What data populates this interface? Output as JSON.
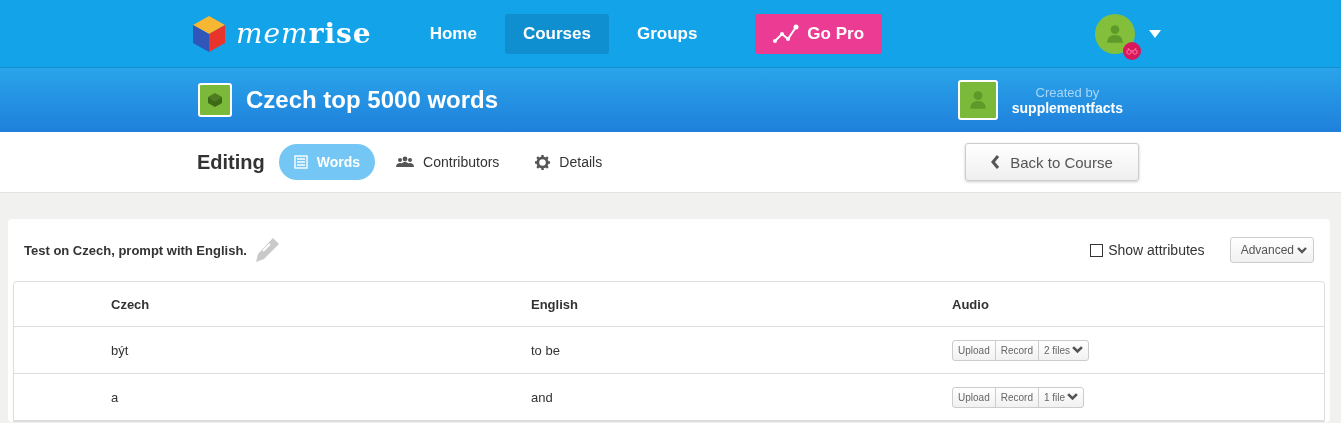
{
  "logo": {
    "text": "mem**rise**"
  },
  "nav": [
    {
      "label": "Home",
      "selected": false
    },
    {
      "label": "Courses",
      "selected": true
    },
    {
      "label": "Groups",
      "selected": false
    }
  ],
  "go_pro": {
    "label": "Go Pro"
  },
  "course": {
    "title": "Czech top 5000 words",
    "created_by_label": "Created by",
    "creator": "supplementfacts"
  },
  "editing": {
    "label": "Editing",
    "tabs": [
      {
        "label": "Words",
        "kind": "list",
        "selected": true
      },
      {
        "label": "Contributors",
        "kind": "people",
        "selected": false
      },
      {
        "label": "Details",
        "kind": "gear",
        "selected": false
      }
    ],
    "back_button": "Back to Course"
  },
  "panel": {
    "description": "Test on Czech, prompt with English.",
    "show_attributes": {
      "label": "Show attributes",
      "checked": false
    },
    "advanced": "Advanced"
  },
  "table": {
    "columns": [
      "Czech",
      "English",
      "Audio"
    ],
    "rows": [
      {
        "czech": "být",
        "english": "to be",
        "audio": {
          "upload": "Upload",
          "record": "Record",
          "files": "2 files"
        }
      },
      {
        "czech": "a",
        "english": "and",
        "audio": {
          "upload": "Upload",
          "record": "Record",
          "files": "1 file"
        }
      }
    ]
  }
}
